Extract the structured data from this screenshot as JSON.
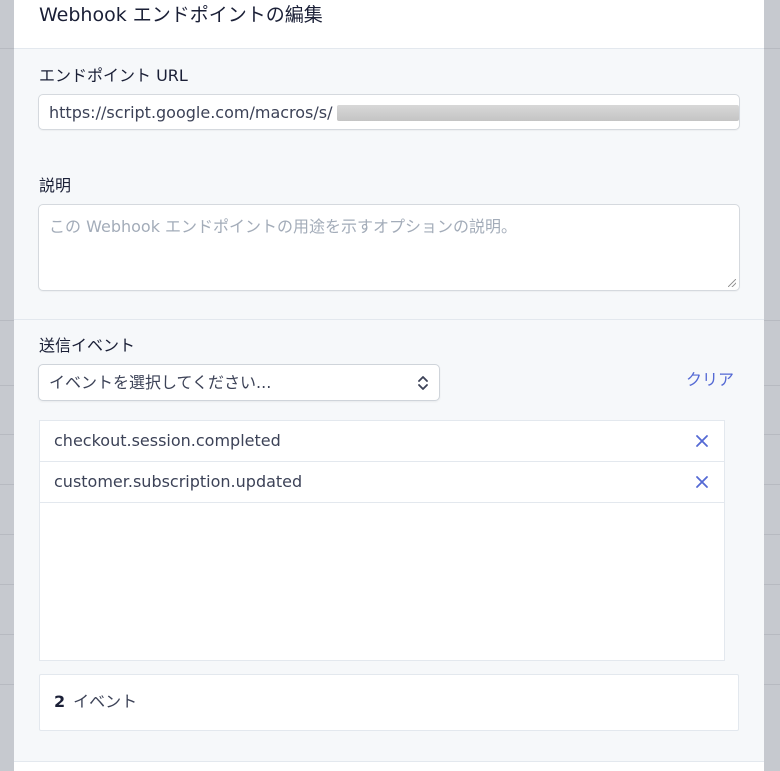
{
  "modal": {
    "title": "Webhook エンドポイントの編集"
  },
  "endpoint_url": {
    "label": "エンドポイント URL",
    "value": "https://script.google.com/macros/s/"
  },
  "description": {
    "label": "説明",
    "placeholder": "この Webhook エンドポイントの用途を示すオプションの説明。"
  },
  "events": {
    "label": "送信イベント",
    "select_placeholder": "イベントを選択してください...",
    "clear_label": "クリア",
    "selected": [
      {
        "name": "checkout.session.completed"
      },
      {
        "name": "customer.subscription.updated"
      }
    ],
    "count": "2",
    "count_suffix": "イベント"
  },
  "colors": {
    "accent": "#5469d4",
    "text": "#1a1f36",
    "muted_text": "#a3acb9"
  },
  "icons": {
    "select": "chevron-up-down-icon",
    "remove": "close-icon"
  }
}
